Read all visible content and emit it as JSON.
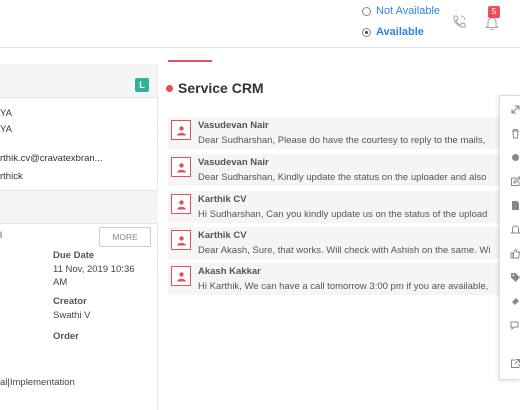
{
  "status": {
    "not_available_label": "Not Available",
    "available_label": "Available",
    "selected": "Available"
  },
  "notifications": {
    "count": "5"
  },
  "left_panel": {
    "badge": "L",
    "line1": "YA",
    "line2": "YA",
    "email": "rthik.cv@cravatexbran...",
    "name": "rthick",
    "more_button": "MORE",
    "due_date_label": "Due Date",
    "due_date_value_1": "11 Nov, 2019 10:36",
    "due_date_value_2": "AM",
    "creator_label": "Creator",
    "creator_value": "Swathi V",
    "order_label": "Order",
    "category": "al|Implementation"
  },
  "main": {
    "title": "Service CRM",
    "comments": [
      {
        "author": "Vasudevan Nair",
        "text": "Dear Sudharshan, Please do have the courtesy to reply to the mails,"
      },
      {
        "author": "Vasudevan Nair",
        "text": "Dear Sudharshan,  Kindly update the status on the uploader and also"
      },
      {
        "author": "Karthik CV",
        "text": "Hi Sudharshan, Can you kindly update us on the status of the upload"
      },
      {
        "author": "Karthik CV",
        "text": "Dear Akash, Sure, that works. Will check with Ashish on the same. Wi"
      },
      {
        "author": "Akash Kakkar",
        "text": "Hi Karthik, We can have a call tomorrow 3:00 pm if you are available,"
      }
    ]
  },
  "colors": {
    "accent_red": "#e5505a",
    "link_blue": "#2e86de",
    "badge_green": "#2fb39b"
  },
  "side_tools": [
    "expand-icon",
    "trash-icon",
    "dot-icon",
    "edit-icon",
    "document-icon",
    "bell-icon",
    "thumbs-up-icon",
    "tag-icon",
    "ticket-icon",
    "chat-icon",
    "external-link-icon"
  ]
}
